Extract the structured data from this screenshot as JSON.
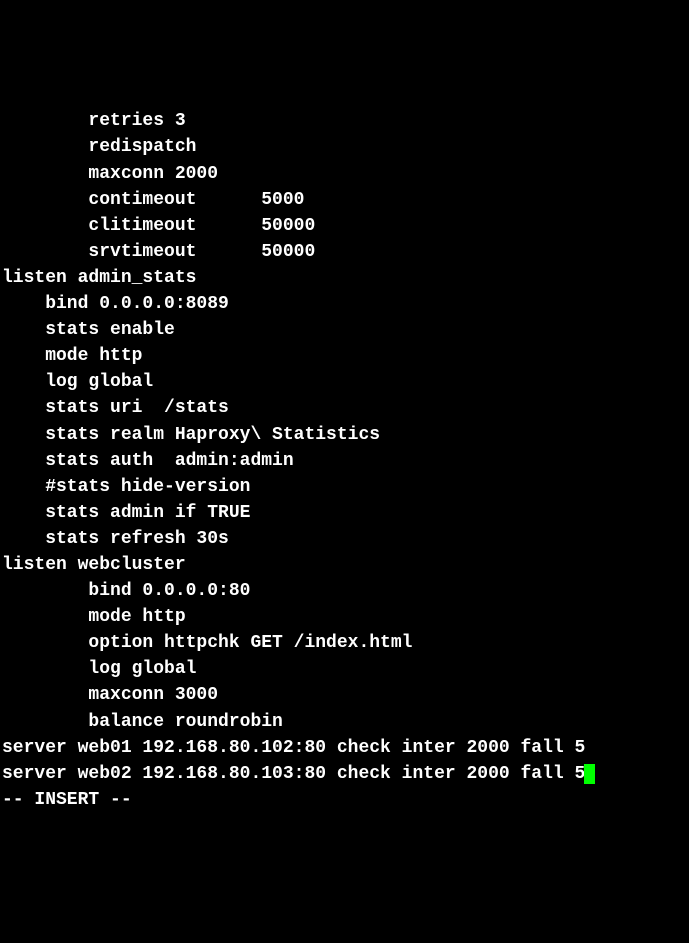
{
  "terminal": {
    "lines": [
      "        retries 3",
      "        redispatch",
      "        maxconn 2000",
      "        contimeout      5000",
      "        clitimeout      50000",
      "        srvtimeout      50000",
      "",
      "listen admin_stats",
      "    bind 0.0.0.0:8089",
      "    stats enable",
      "    mode http",
      "    log global",
      "    stats uri  /stats",
      "    stats realm Haproxy\\ Statistics",
      "    stats auth  admin:admin",
      "    #stats hide-version",
      "    stats admin if TRUE",
      "    stats refresh 30s",
      "",
      "listen webcluster",
      "        bind 0.0.0.0:80",
      "        mode http",
      "        option httpchk GET /index.html",
      "        log global",
      "        maxconn 3000",
      "        balance roundrobin",
      "server web01 192.168.80.102:80 check inter 2000 fall 5"
    ],
    "cursor_line": "server web02 192.168.80.103:80 check inter 2000 fall 5",
    "status_line": "-- INSERT --"
  }
}
